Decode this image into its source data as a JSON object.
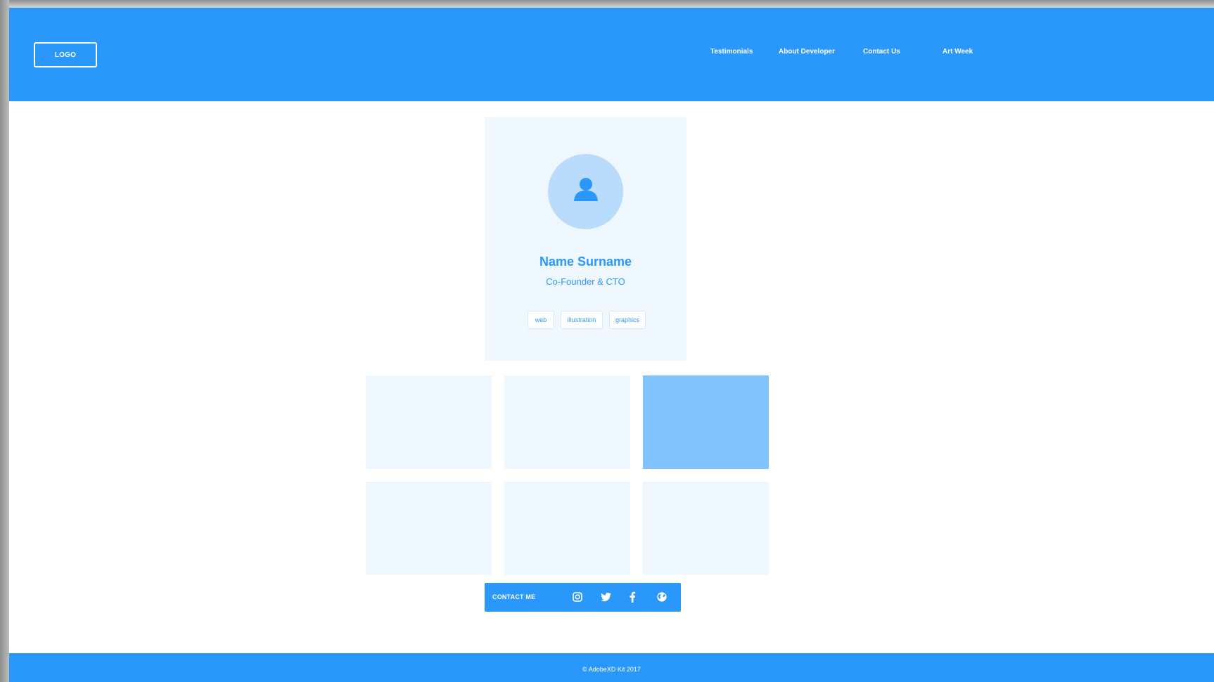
{
  "header": {
    "logo_label": "LOGO",
    "nav": [
      {
        "label": "Testimonials"
      },
      {
        "label": "About Developer"
      },
      {
        "label": "Contact Us"
      },
      {
        "label": "Art Week"
      }
    ]
  },
  "profile": {
    "avatar_icon": "user-icon",
    "name": "Name Surname",
    "role": "Co-Founder & CTO",
    "tags": [
      "web",
      "illustration",
      "graphics"
    ]
  },
  "gallery": {
    "tiles": [
      {
        "state": "default"
      },
      {
        "state": "default"
      },
      {
        "state": "active"
      },
      {
        "state": "default"
      },
      {
        "state": "default"
      },
      {
        "state": "default"
      }
    ]
  },
  "contact": {
    "label": "CONTACT ME",
    "icons": [
      "instagram-icon",
      "twitter-icon",
      "facebook-icon",
      "globe-icon"
    ]
  },
  "footer": {
    "text": "© AdobeXD Kit 2017"
  },
  "colors": {
    "brand": "#2a98fb",
    "light": "#eff7ff",
    "active_tile": "#80c3fd",
    "avatar_bg": "#b9dcfd"
  }
}
